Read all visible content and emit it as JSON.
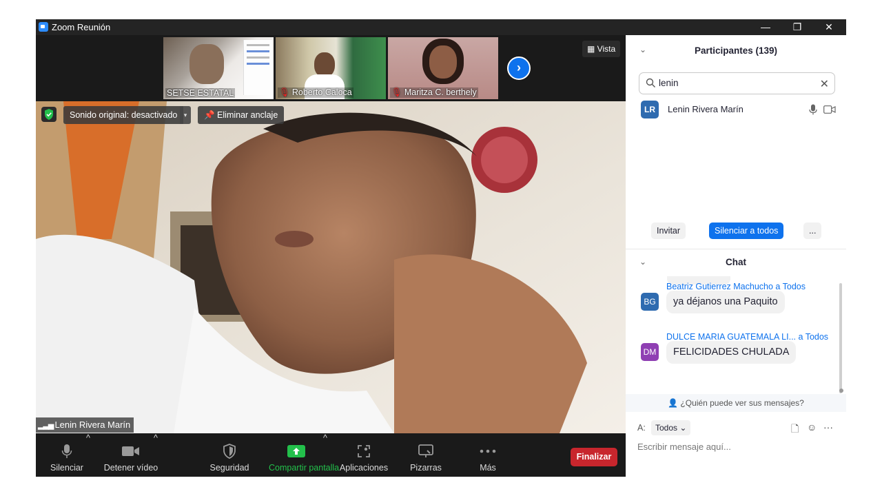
{
  "window": {
    "title": "Zoom Reunión",
    "minimize": "—",
    "restore": "❐",
    "close": "✕"
  },
  "thumbnails": [
    {
      "name": "SETSE ESTATAL",
      "muted": false
    },
    {
      "name": "Roberto Caloca",
      "muted": true
    },
    {
      "name": "Maritza C. berthely",
      "muted": true
    }
  ],
  "view_button": "Vista",
  "next_arrow": "›",
  "sound_original": "Sonido original: desactivado",
  "sound_caret": "▾",
  "unpin": "Eliminar anclaje",
  "speaker_name": "Lenin Rivera Marín",
  "toolbar": {
    "mute": "Silenciar",
    "stop_video": "Detener vídeo",
    "security": "Seguridad",
    "share_screen": "Compartir pantalla",
    "apps": "Aplicaciones",
    "whiteboards": "Pizarras",
    "more": "Más",
    "end": "Finalizar",
    "caret": "^"
  },
  "participants": {
    "title": "Participantes (139)",
    "search_value": "lenin",
    "list": [
      {
        "initials": "LR",
        "name": "Lenin Rivera Marín",
        "color": "#2e6bb0"
      }
    ],
    "invite": "Invitar",
    "mute_all": "Silenciar a todos",
    "more": "..."
  },
  "chat": {
    "title": "Chat",
    "messages": [
      {
        "initials": "BG",
        "sender": "Beatriz Gutierrez Machucho",
        "to": "a Todos",
        "text": "ya déjanos una Paquito",
        "color": "#2e6bb0"
      },
      {
        "initials": "DM",
        "sender": "DULCE MARIA GUATEMALA LI...",
        "to": "a Todos",
        "text": "FELICIDADES CHULADA",
        "color": "#8f3fb3"
      }
    ],
    "who_sees": "¿Quién puede ver sus mensajes?",
    "to_label": "A:",
    "to_value": "Todos",
    "placeholder": "Escribir mensaje aquí..."
  },
  "colors": {
    "accent": "#0e72ed",
    "end": "#c8262d",
    "share": "#23c04b"
  }
}
